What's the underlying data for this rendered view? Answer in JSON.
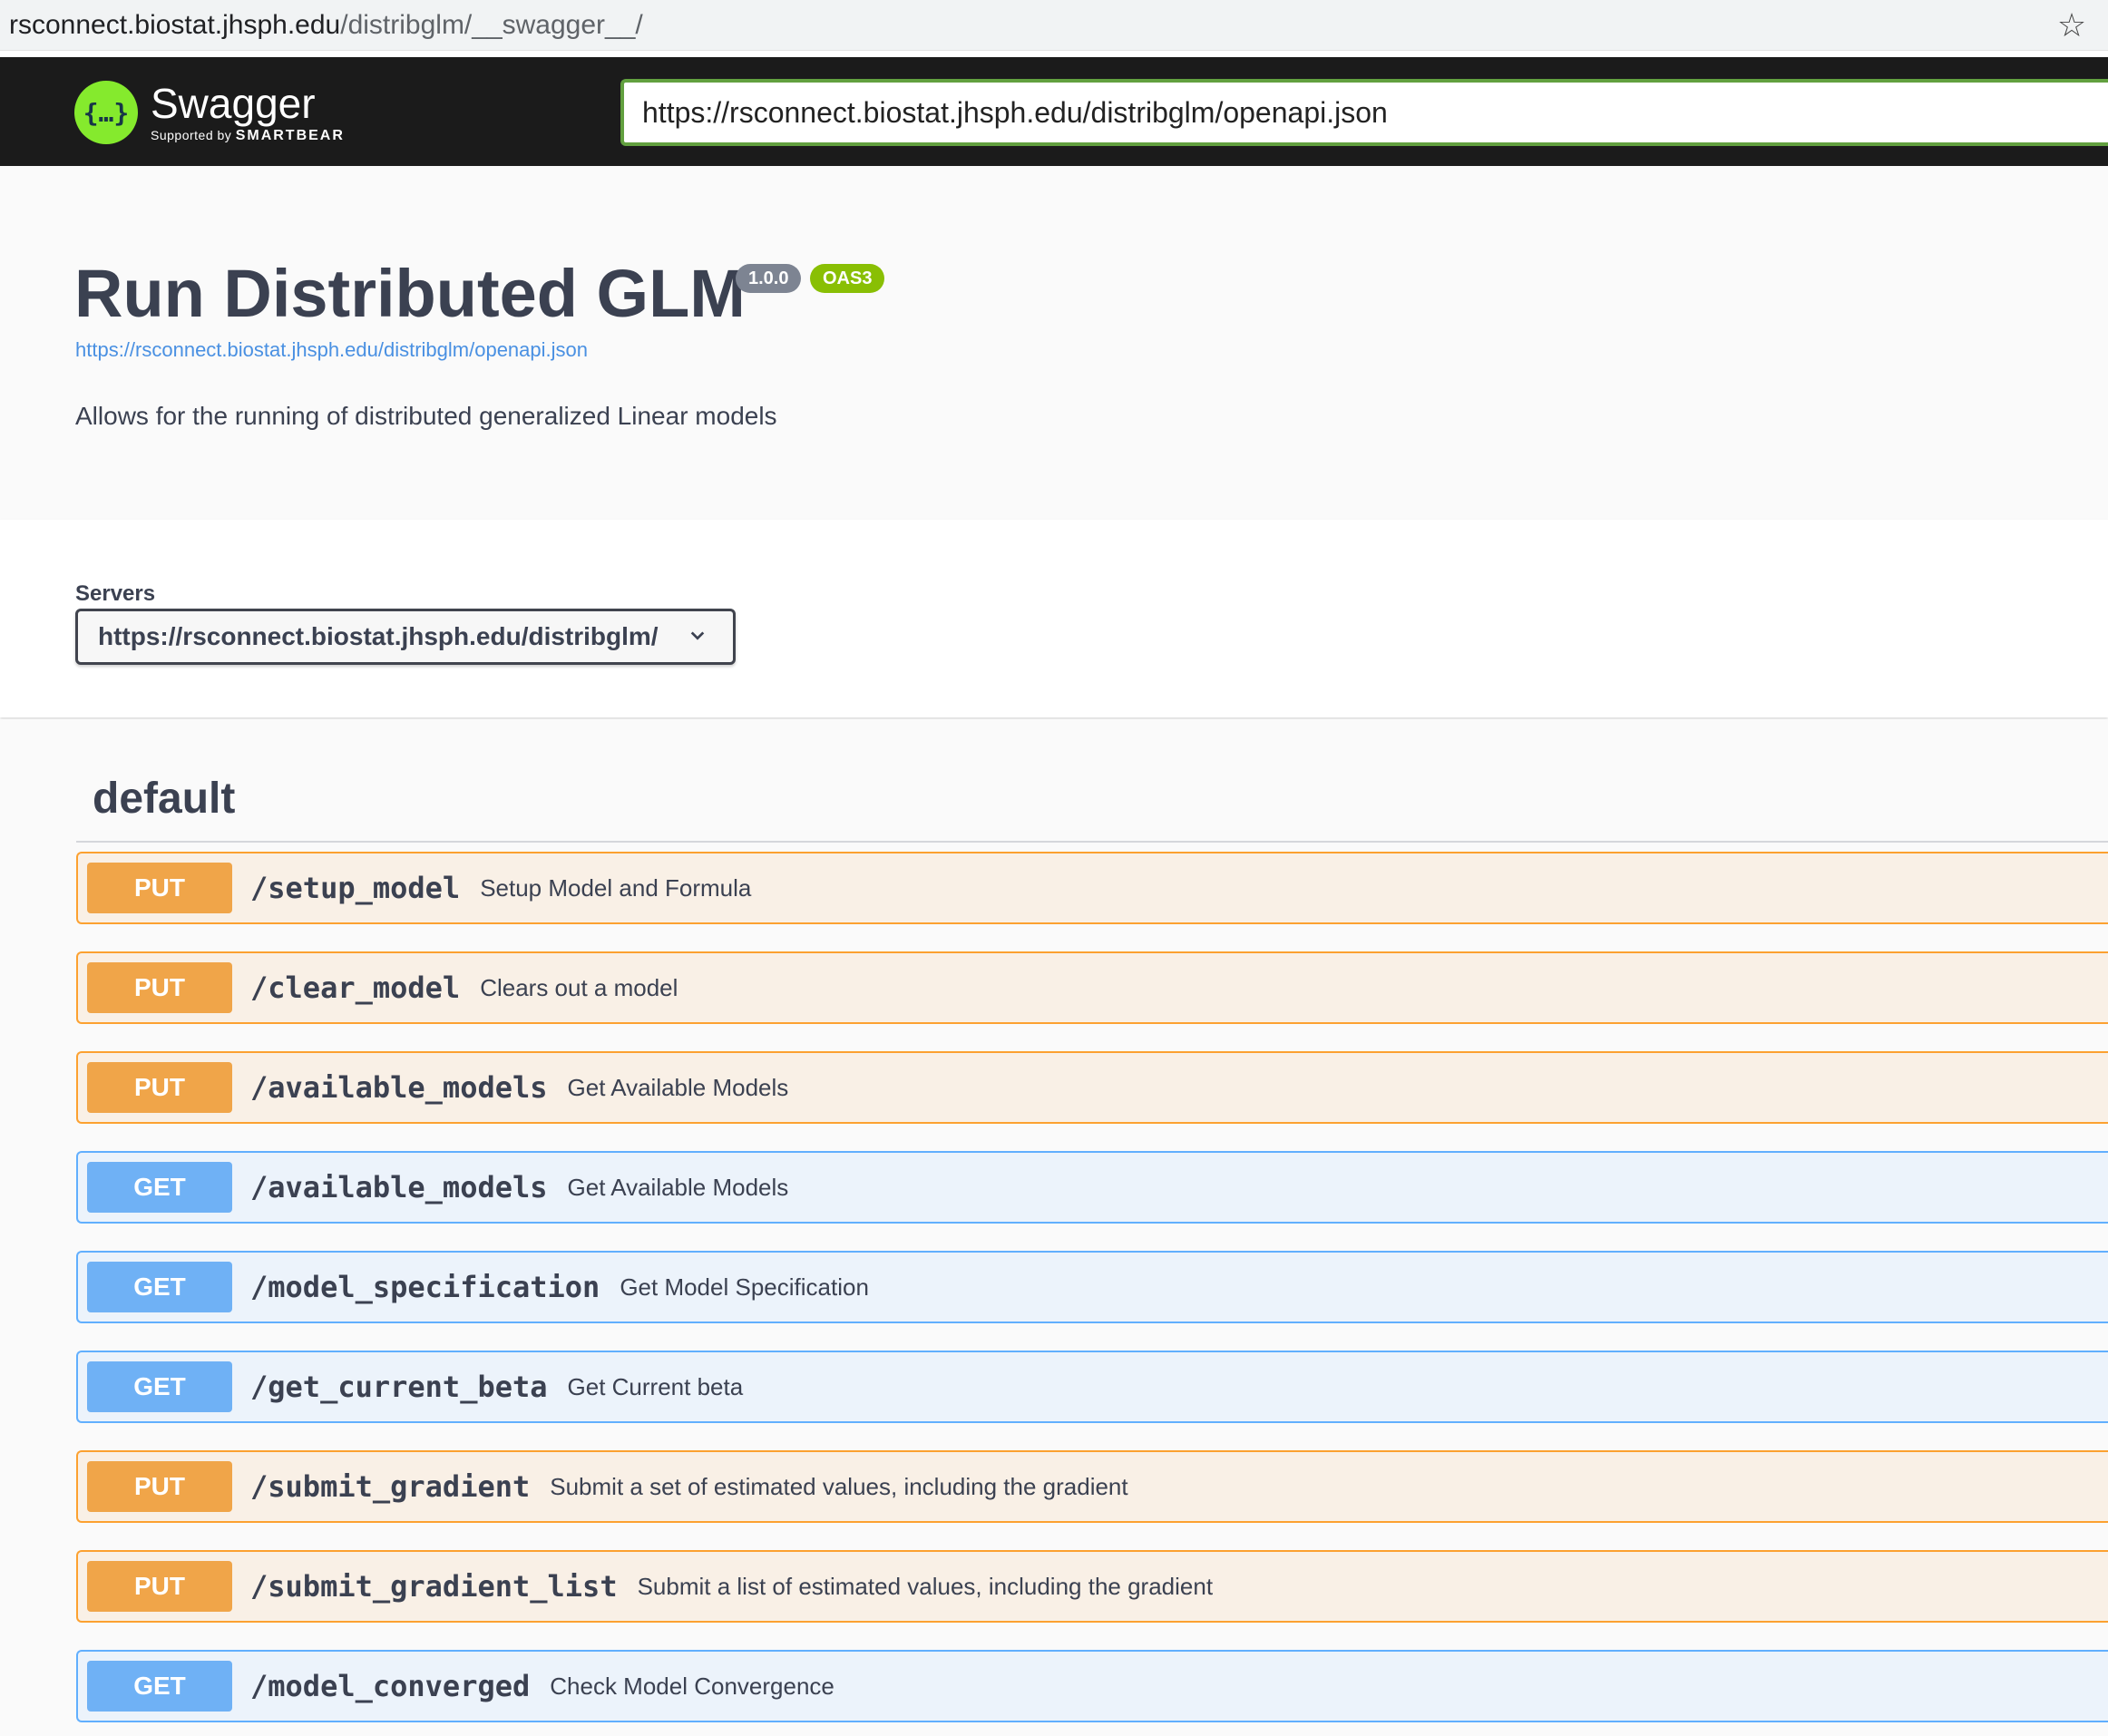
{
  "browser": {
    "url_host": "rsconnect.biostat.jhsph.edu",
    "url_path": "/distribglm/__swagger__/"
  },
  "topbar": {
    "logo_title": "Swagger",
    "logo_supported_by": "Supported by",
    "logo_brand": "SMARTBEAR",
    "spec_url": "https://rsconnect.biostat.jhsph.edu/distribglm/openapi.json"
  },
  "info": {
    "title": "Run Distributed GLM",
    "version": "1.0.0",
    "oas": "OAS3",
    "spec_link": "https://rsconnect.biostat.jhsph.edu/distribglm/openapi.json",
    "description": "Allows for the running of distributed generalized Linear models"
  },
  "servers": {
    "label": "Servers",
    "selected": "https://rsconnect.biostat.jhsph.edu/distribglm/"
  },
  "tag": {
    "name": "default"
  },
  "operations": [
    {
      "method": "PUT",
      "path": "/setup_model",
      "summary": "Setup Model and Formula"
    },
    {
      "method": "PUT",
      "path": "/clear_model",
      "summary": "Clears out a model"
    },
    {
      "method": "PUT",
      "path": "/available_models",
      "summary": "Get Available Models"
    },
    {
      "method": "GET",
      "path": "/available_models",
      "summary": "Get Available Models"
    },
    {
      "method": "GET",
      "path": "/model_specification",
      "summary": "Get Model Specification"
    },
    {
      "method": "GET",
      "path": "/get_current_beta",
      "summary": "Get Current beta"
    },
    {
      "method": "PUT",
      "path": "/submit_gradient",
      "summary": "Submit a set of estimated values, including the gradient"
    },
    {
      "method": "PUT",
      "path": "/submit_gradient_list",
      "summary": "Submit a list of estimated values, including the gradient"
    },
    {
      "method": "GET",
      "path": "/model_converged",
      "summary": "Check Model Convergence"
    }
  ]
}
